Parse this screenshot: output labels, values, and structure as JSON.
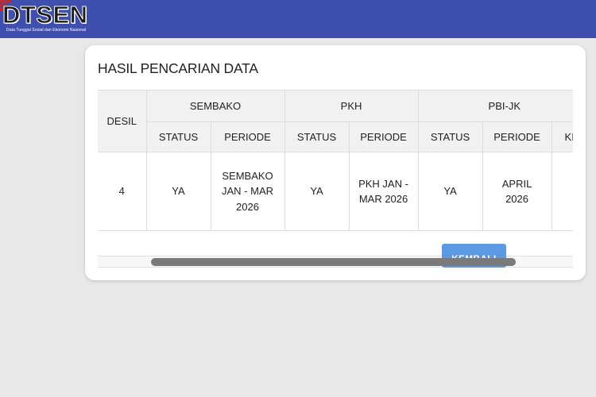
{
  "header": {
    "logo_text": "DTSEN",
    "logo_subtitle": "Data Tunggal Sosial dan Ekonomi Nasional",
    "brand_color": "#3f4fae"
  },
  "card": {
    "title": "HASIL PENCARIAN DATA"
  },
  "table": {
    "desil_header": "DESIL",
    "groups": [
      "SEMBAKO",
      "PKH",
      "PBI-JK"
    ],
    "sub_headers": [
      "STATUS",
      "PERIODE",
      "STATUS",
      "PERIODE",
      "STATUS",
      "PERIODE",
      "KI"
    ],
    "row": {
      "desil": "4",
      "cells": [
        "YA",
        "SEMBAKO JAN - MAR 2026",
        "YA",
        "PKH JAN - MAR 2026",
        "YA",
        "APRIL 2026",
        ""
      ]
    }
  },
  "back_button_label": "KEMBALI"
}
